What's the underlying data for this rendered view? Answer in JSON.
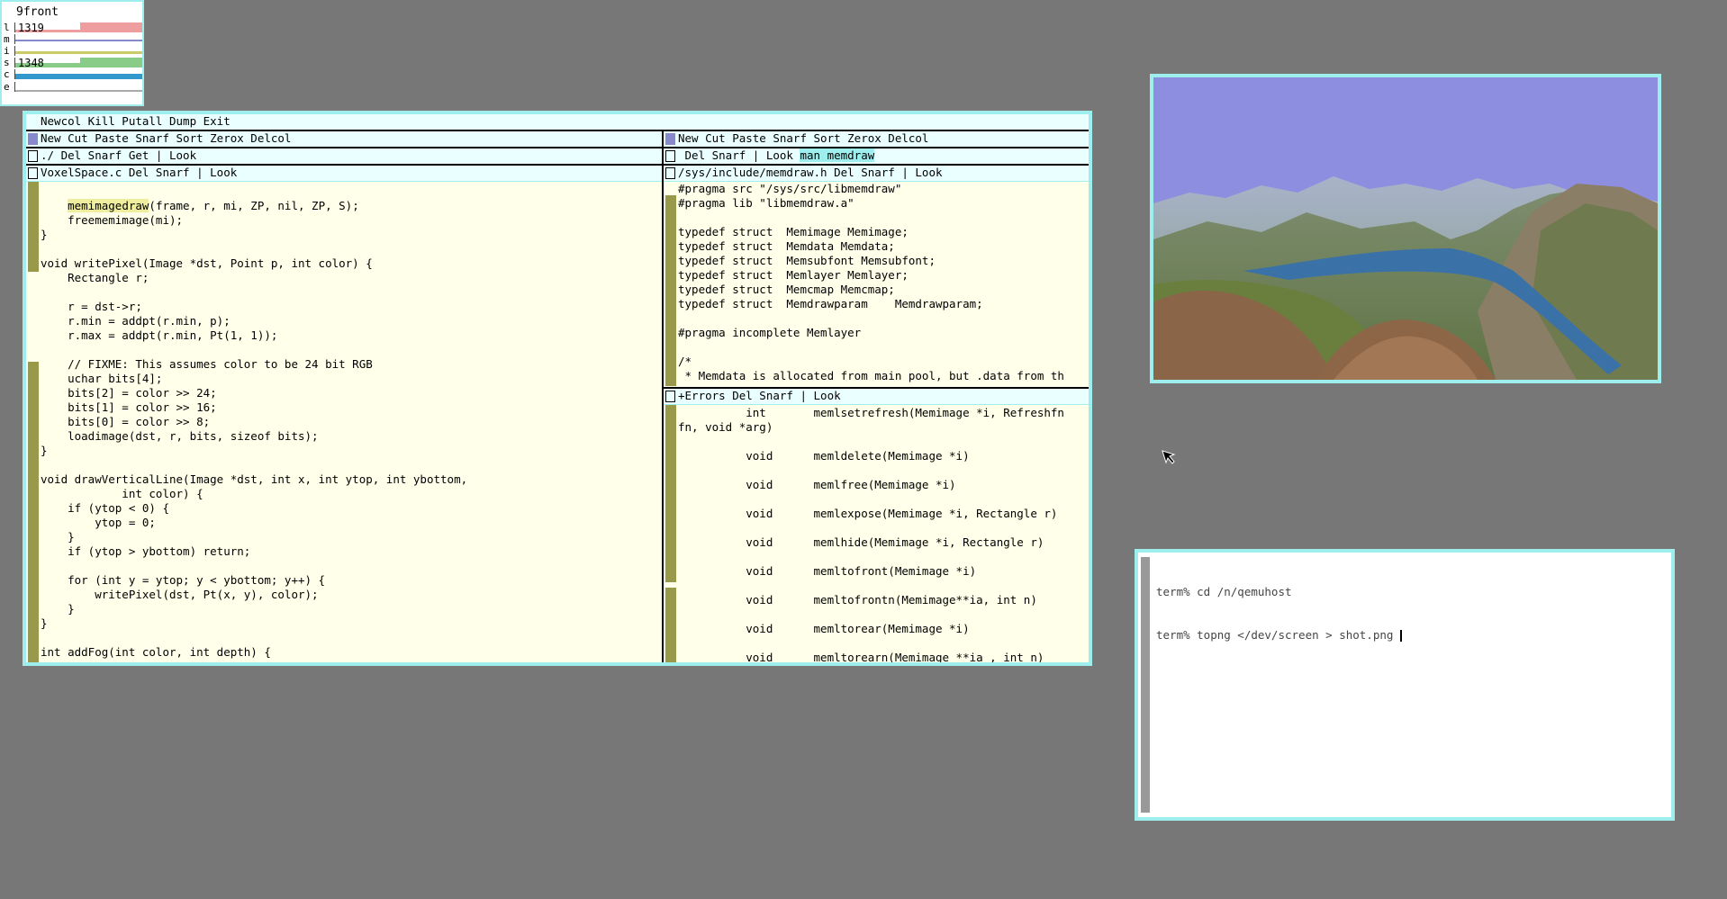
{
  "stats": {
    "title": "9front",
    "rows": [
      {
        "label": "l",
        "value": "1319",
        "color": "#ee9e9e"
      },
      {
        "label": "m",
        "value": "",
        "color": "#8888cc"
      },
      {
        "label": "i",
        "value": "",
        "color": "#eeee9e"
      },
      {
        "label": "s",
        "value": "1348",
        "color": "#88cc88"
      },
      {
        "label": "c",
        "value": "",
        "color": "#3399cc"
      },
      {
        "label": "e",
        "value": "",
        "color": "#cccccc"
      }
    ]
  },
  "acme": {
    "main_tag": "Newcol Kill Putall Dump Exit",
    "left_col_tag": "New Cut Paste Snarf Sort Zerox Delcol ",
    "right_col_tag": "New Cut Paste Snarf Sort Zerox Delcol ",
    "dir_tag": "./ Del Snarf Get | Look ",
    "voxel_tag": "VoxelSpace.c Del Snarf | Look ",
    "man_tag_prefix": " Del Snarf | Look ",
    "man_tag_sel": "man memdraw",
    "memdraw_tag": "/sys/include/memdraw.h Del Snarf | Look ",
    "errors_tag": "+Errors Del Snarf | Look",
    "voxel_lines": [
      "",
      "    memimagedraw(frame, r, mi, ZP, nil, ZP, S);",
      "    freememimage(mi);",
      "}",
      "",
      "void writePixel(Image *dst, Point p, int color) {",
      "    Rectangle r;",
      "",
      "    r = dst->r;",
      "    r.min = addpt(r.min, p);",
      "    r.max = addpt(r.min, Pt(1, 1));",
      "",
      "    // FIXME: This assumes color to be 24 bit RGB",
      "    uchar bits[4];",
      "    bits[2] = color >> 24;",
      "    bits[1] = color >> 16;",
      "    bits[0] = color >> 8;",
      "    loadimage(dst, r, bits, sizeof bits);",
      "}",
      "",
      "void drawVerticalLine(Image *dst, int x, int ytop, int ybottom,",
      "            int color) {",
      "    if (ytop < 0) {",
      "        ytop = 0;",
      "    }",
      "    if (ytop > ybottom) return;",
      "",
      "    for (int y = ytop; y < ybottom; y++) {",
      "        writePixel(dst, Pt(x, y), color);",
      "    }",
      "}",
      "",
      "int addFog(int color, int depth) {"
    ],
    "memdraw_lines": [
      "#pragma src \"/sys/src/libmemdraw\"",
      "#pragma lib \"libmemdraw.a\"",
      "",
      "typedef struct  Memimage Memimage;",
      "typedef struct  Memdata Memdata;",
      "typedef struct  Memsubfont Memsubfont;",
      "typedef struct  Memlayer Memlayer;",
      "typedef struct  Memcmap Memcmap;",
      "typedef struct  Memdrawparam    Memdrawparam;",
      "",
      "#pragma incomplete Memlayer",
      "",
      "/*",
      " * Memdata is allocated from main pool, but .data from th"
    ],
    "errors_lines": [
      "          int       memlsetrefresh(Memimage *i, Refreshfn",
      "fn, void *arg)",
      "",
      "          void      memldelete(Memimage *i)",
      "",
      "          void      memlfree(Memimage *i)",
      "",
      "          void      memlexpose(Memimage *i, Rectangle r)",
      "",
      "          void      memlhide(Memimage *i, Rectangle r)",
      "",
      "          void      memltofront(Memimage *i)",
      "",
      "          void      memltofrontn(Memimage**ia, int n)",
      "",
      "          void      memltorear(Memimage *i)",
      "",
      "          void      memltorearn(Memimage **ia , int n)"
    ]
  },
  "term": {
    "lines": [
      "term% cd /n/qemuhost",
      "term% topng </dev/screen > shot.png "
    ]
  },
  "colors": {
    "desktop": "#777777",
    "border": "#9eeeee",
    "acme_body": "#ffffea",
    "acme_tag": "#eaffff",
    "scrollbar": "#99994c"
  }
}
